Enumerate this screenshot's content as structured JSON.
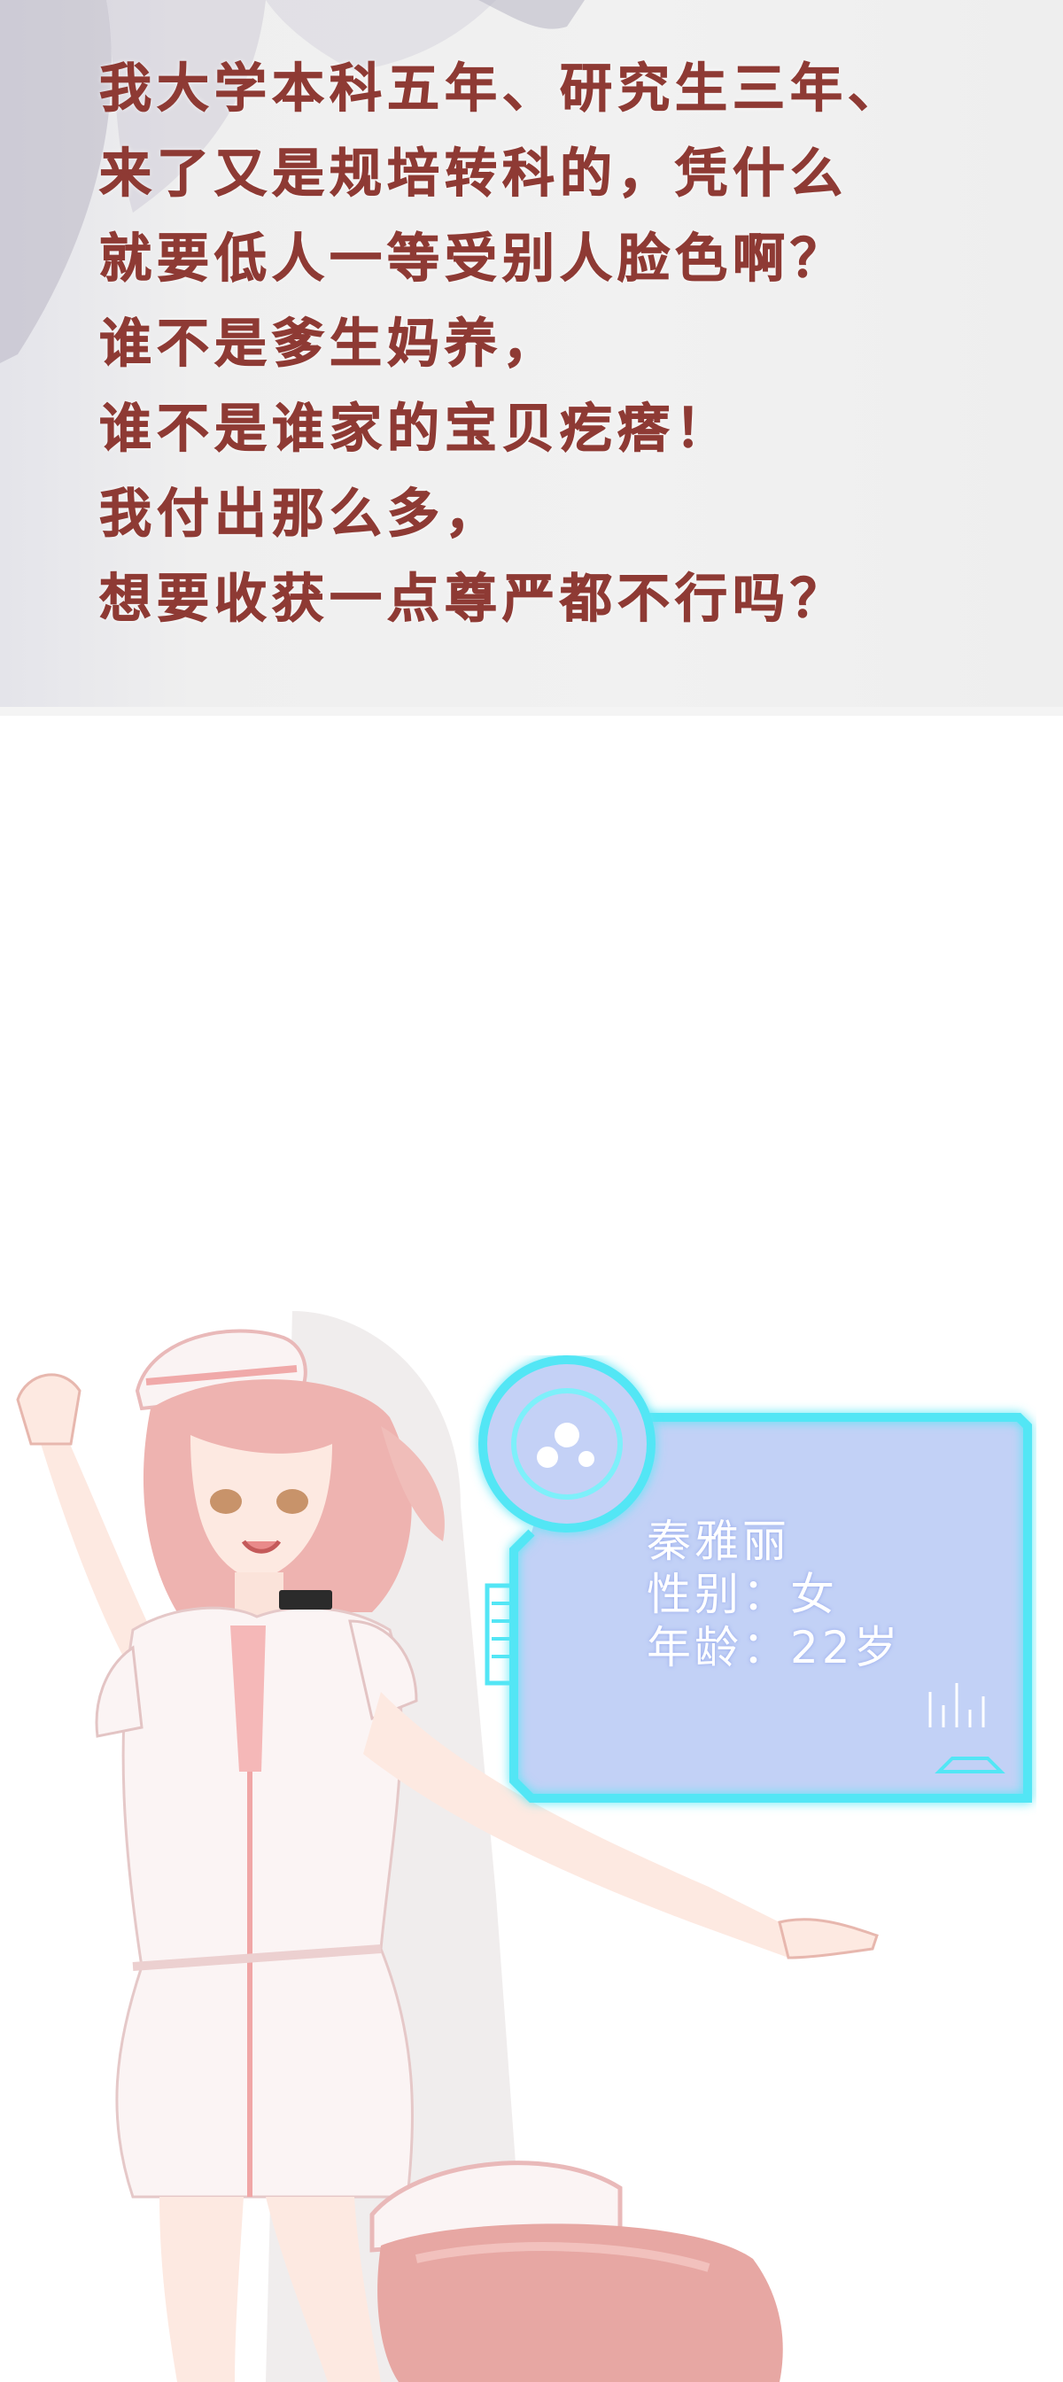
{
  "dialogue": {
    "lines": [
      "我大学本科五年、研究生三年、",
      "来了又是规培转科的，凭什么",
      "就要低人一等受别人脸色啊？",
      "谁不是爹生妈养，",
      "谁不是谁家的宝贝疙瘩！",
      "我付出那么多，",
      "想要收获一点尊严都不行吗？"
    ],
    "color": "#8e3a34"
  },
  "profile_card": {
    "name": "秦雅丽",
    "gender": "性别：女",
    "age": "年龄：22岁",
    "accent_color": "#53e6f5",
    "panel_color": "#b7c9f5"
  },
  "character": {
    "description_icon": "nurse-character-illustration",
    "hair_color": "#eeb3b0",
    "uniform_color": "#fbf4f4"
  }
}
